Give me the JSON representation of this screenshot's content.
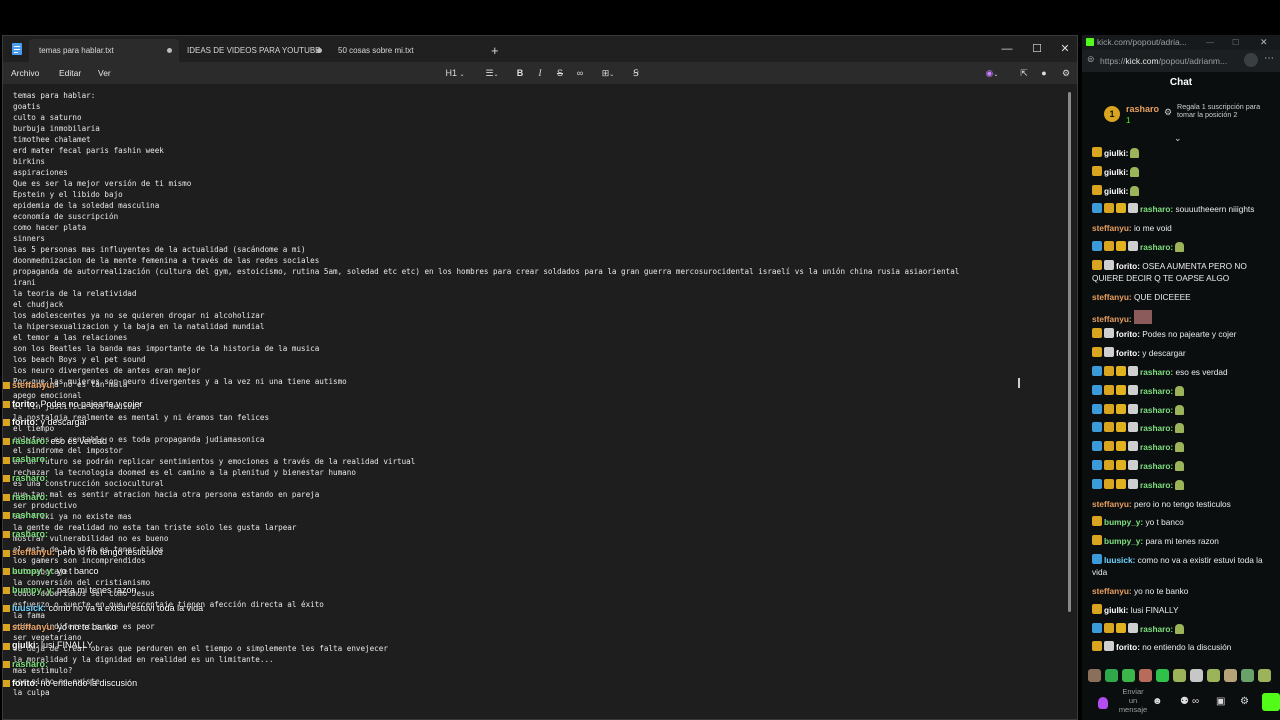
{
  "notepad": {
    "tabs": [
      {
        "label": "temas para hablar.txt",
        "active": true
      },
      {
        "label": "IDEAS DE VIDEOS PARA YOUTUBE",
        "active": false
      },
      {
        "label": "50 cosas sobre mi.txt",
        "active": false
      }
    ],
    "new_tab": "+",
    "window_buttons": {
      "minimize": "—",
      "maximize": "☐",
      "close": "✕"
    },
    "menu": {
      "archivo": "Archivo",
      "editar": "Editar",
      "ver": "Ver"
    },
    "toolbar": {
      "heading": "H1",
      "bold": "B",
      "italic": "I"
    },
    "lines": [
      "temas para hablar:",
      "goatis",
      "culto a saturno",
      "burbuja inmobilaria",
      "timothee chalamet",
      "erd mater fecal paris fashin week",
      "birkins",
      "aspiraciones",
      "Que es ser la mejor versión de ti mismo",
      "Epstein y el libido bajo",
      "epidemia de la soledad masculina",
      "economía de suscripción",
      "como hacer plata",
      "sinners",
      "las 5 personas mas influyentes de la actualidad (sacándome a mi)",
      "doonmednizacion de la mente femenina a través de las redes sociales",
      "propaganda de autorrealización (cultura del gym, estoicismo, rutina 5am, soledad etc etc) en los hombres para crear soldados para la gran guerra mercosurocidental israelí vs la unión china rusia asiaoriental",
      "irani",
      "la teoria de la relatividad",
      "el chudjack",
      "los adolescentes ya no se quieren drogar ni alcoholizar",
      "la hipersexualizacion y la baja en la natalidad mundial",
      "el temor a las relaciones",
      "son los Beatles la banda mas importante de la historia de la musica",
      "los beach Boys y el pet sound",
      "los neuro divergentes de antes eran mejor",
      "Por que las mujeres son neuro divergentes y a la vez ni una tiene autismo"
    ],
    "lines_lower": [
      "",
      "la cocaina no es tán mala",
      "apego emocional",
      "el fin justifica los medios?",
      "la nostalgia realmente es mental y ni éramos tan felices",
      "el tiempo",
      "onlyfans es rentable o es toda propaganda judiamasonica",
      "el sindrome del impostor",
      "en un futuro se podrán replicar sentimientos y emociones a través de la realidad virtual",
      "rechazar la tecnologia doomed es el camino a la plenitud y bienestar humano",
      "es una construcción sociocultural",
      "que tan mal es sentir atracion hacia otra persona estando en pareja",
      "ser productivo",
      "ser friki ya no existe mas",
      "la gente de realidad no esta tan triste solo les gusta larpear",
      "mostrar vulnerabilidad no es bueno",
      "el meta de la vida es tener hijos",
      "los gamers son incomprendidos",
      "autosabotaje",
      "la conversión del cristianismo",
      "todos deberiamos ser como Jesus",
      "esfuerzo o suerte en que porcentaje tienen afección directa al éxito",
      "la fama",
      "odio o indiferencia que es peor",
      "ser vegetariano",
      "se deja de crear obras que perduren en el tiempo o simplemente les falta envejecer",
      "la moralidad y la dignidad en realidad es un limitante...",
      "mas estimulo?",
      "ser nicho no existe",
      "la culpa"
    ],
    "overlay_chat": [
      {
        "user": "steffanyu:",
        "text": "",
        "user_color": "#e8a060"
      },
      {
        "user": "forito:",
        "text": "Podes no pajearte y cojer",
        "user_color": "#ffffff"
      },
      {
        "user": "forito:",
        "text": "y descargar",
        "user_color": "#ffffff"
      },
      {
        "user": "rasharo:",
        "text": "eso es verdad",
        "user_color": "#7ee07e"
      },
      {
        "user": "rasharo:",
        "text": "",
        "user_color": "#7ee07e"
      },
      {
        "user": "rasharo:",
        "text": "",
        "user_color": "#7ee07e"
      },
      {
        "user": "rasharo:",
        "text": "",
        "user_color": "#7ee07e"
      },
      {
        "user": "rasharo:",
        "text": "",
        "user_color": "#7ee07e"
      },
      {
        "user": "rasharo:",
        "text": "",
        "user_color": "#7ee07e"
      },
      {
        "user": "steffanyu:",
        "text": "pero io no tengo testiculos",
        "user_color": "#e8a060"
      },
      {
        "user": "bumpy_y:",
        "text": "yo t banco",
        "user_color": "#7ee07e"
      },
      {
        "user": "bumpy_y:",
        "text": "para mi tenes razon",
        "user_color": "#7ee07e"
      },
      {
        "user": "luusick:",
        "text": "como no va a existir estuvi toda la vida",
        "user_color": "#6fd3ff"
      },
      {
        "user": "steffanyu:",
        "text": "yo no te banko",
        "user_color": "#e8a060"
      },
      {
        "user": "giulki:",
        "text": "lusi FINALLY",
        "user_color": "#ffffff"
      },
      {
        "user": "rasharo:",
        "text": "",
        "user_color": "#7ee07e"
      },
      {
        "user": "forito:",
        "text": "no entiendo la discusión",
        "user_color": "#ffffff"
      }
    ]
  },
  "kick": {
    "window_title": "kick.com/popout/adria...",
    "url_prefix": "https://",
    "url_host": "kick.com",
    "url_rest": "/popout/adrianm...",
    "chat_label": "Chat",
    "pinned": {
      "rank": "1",
      "user": "rasharo",
      "count": "1",
      "gift_text": "Regala 1 suscripción para tomar la posición",
      "gift_pos": "2"
    },
    "messages": [
      {
        "user": "giulki:",
        "text": "",
        "user_color": "#ffffff",
        "badges": "crown",
        "emote": true
      },
      {
        "user": "giulki:",
        "text": "",
        "user_color": "#ffffff",
        "badges": "crown",
        "emote": true
      },
      {
        "user": "giulki:",
        "text": "",
        "user_color": "#ffffff",
        "badges": "crown",
        "emote": true
      },
      {
        "user": "rasharo:",
        "text": "souuutheeern niiights",
        "user_color": "#7ee07e",
        "badges": "full",
        "emote": false
      },
      {
        "user": "steffanyu:",
        "text": "io me void",
        "user_color": "#e8a060",
        "badges": "none",
        "emote": false
      },
      {
        "user": "rasharo:",
        "text": "",
        "user_color": "#7ee07e",
        "badges": "full",
        "emote": true
      },
      {
        "user": "forito:",
        "text": "OSEA AUMENTA PERO NO QUIERE DECIR Q TE OAPSE ALGO",
        "user_color": "#ffffff",
        "badges": "crown2",
        "emote": false
      },
      {
        "user": "steffanyu:",
        "text": "QUE DICEEEE",
        "user_color": "#e8a060",
        "badges": "none",
        "emote": false
      },
      {
        "user": "steffanyu:",
        "text": "",
        "user_color": "#e8a060",
        "badges": "none",
        "emote": false,
        "image": true
      },
      {
        "user": "forito:",
        "text": "Podes no pajearte y cojer",
        "user_color": "#ffffff",
        "badges": "crown2",
        "emote": false
      },
      {
        "user": "forito:",
        "text": "y descargar",
        "user_color": "#ffffff",
        "badges": "crown2",
        "emote": false
      },
      {
        "user": "rasharo:",
        "text": "eso es verdad",
        "user_color": "#7ee07e",
        "badges": "full",
        "emote": false
      },
      {
        "user": "rasharo:",
        "text": "",
        "user_color": "#7ee07e",
        "badges": "full",
        "emote": true
      },
      {
        "user": "rasharo:",
        "text": "",
        "user_color": "#7ee07e",
        "badges": "full",
        "emote": true
      },
      {
        "user": "rasharo:",
        "text": "",
        "user_color": "#7ee07e",
        "badges": "full",
        "emote": true
      },
      {
        "user": "rasharo:",
        "text": "",
        "user_color": "#7ee07e",
        "badges": "full",
        "emote": true
      },
      {
        "user": "rasharo:",
        "text": "",
        "user_color": "#7ee07e",
        "badges": "full",
        "emote": true
      },
      {
        "user": "rasharo:",
        "text": "",
        "user_color": "#7ee07e",
        "badges": "full",
        "emote": true
      },
      {
        "user": "steffanyu:",
        "text": "pero io no tengo testiculos",
        "user_color": "#e8a060",
        "badges": "none",
        "emote": false
      },
      {
        "user": "bumpy_y:",
        "text": "yo t banco",
        "user_color": "#7ee07e",
        "badges": "crown",
        "emote": false
      },
      {
        "user": "bumpy_y:",
        "text": "para mi tenes razon",
        "user_color": "#7ee07e",
        "badges": "crown",
        "emote": false
      },
      {
        "user": "luusick:",
        "text": "como no va a existir estuvi toda la vida",
        "user_color": "#6fd3ff",
        "badges": "arrow",
        "emote": false
      },
      {
        "user": "steffanyu:",
        "text": "yo no te banko",
        "user_color": "#e8a060",
        "badges": "none",
        "emote": false
      },
      {
        "user": "giulki:",
        "text": "lusi FINALLY",
        "user_color": "#ffffff",
        "badges": "crown",
        "emote": false
      },
      {
        "user": "rasharo:",
        "text": "",
        "user_color": "#7ee07e",
        "badges": "full",
        "emote": true
      },
      {
        "user": "forito:",
        "text": "no entiendo la discusión",
        "user_color": "#ffffff",
        "badges": "crown2",
        "emote": false
      }
    ],
    "send_label": "Enviar un mensaje",
    "colors": {
      "accent": "#53fc18",
      "bg": "#0b0e0f"
    }
  }
}
